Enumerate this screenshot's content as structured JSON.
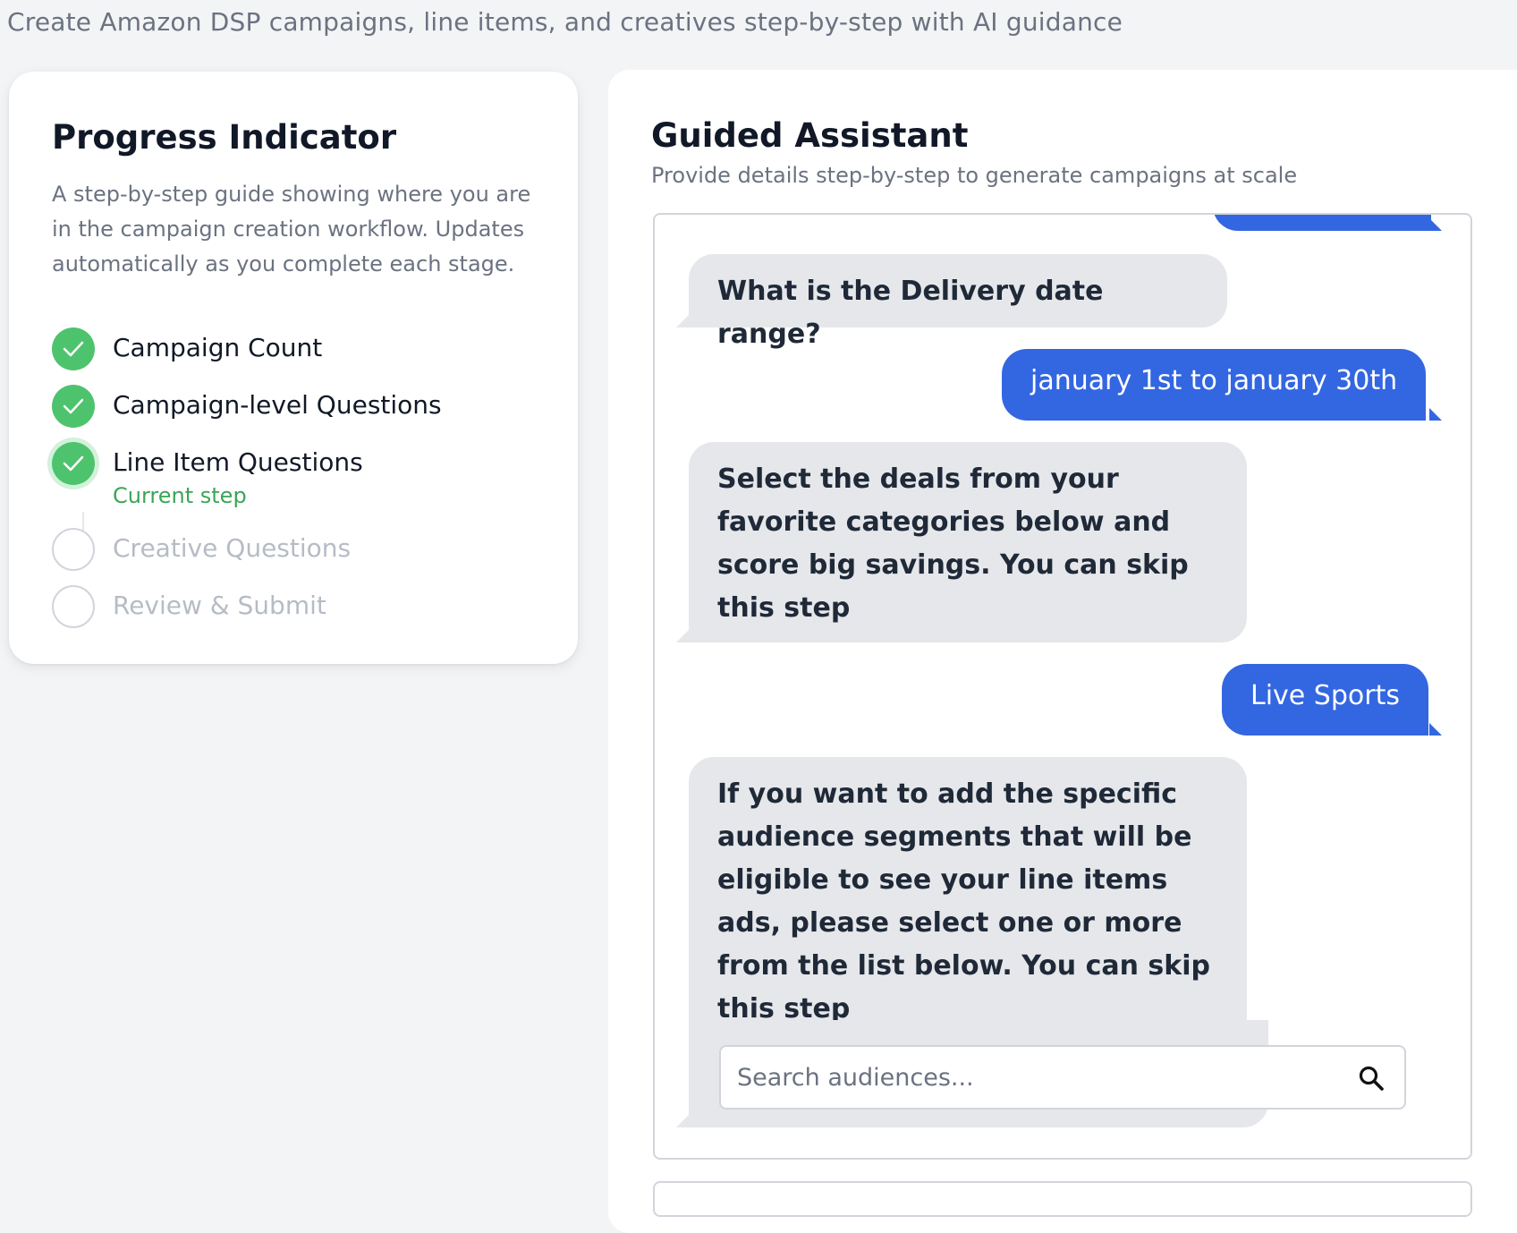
{
  "page": {
    "subtitle": "Create Amazon DSP campaigns, line items, and creatives step-by-step with AI guidance"
  },
  "progress": {
    "title": "Progress Indicator",
    "description": "A step-by-step guide showing where you are in the campaign creation workflow. Updates automatically as you complete each stage.",
    "steps": [
      {
        "label": "Campaign Count",
        "status": "done"
      },
      {
        "label": "Campaign-level Questions",
        "status": "done"
      },
      {
        "label": "Line Item Questions",
        "status": "current",
        "sublabel": "Current step"
      },
      {
        "label": "Creative Questions",
        "status": "pending"
      },
      {
        "label": "Review & Submit",
        "status": "pending"
      }
    ]
  },
  "assistant": {
    "title": "Guided Assistant",
    "subtitle": "Provide details step-by-step to generate campaigns at scale",
    "messages": [
      {
        "role": "bot",
        "text": "What is the Delivery date range?"
      },
      {
        "role": "user",
        "text": "january 1st to january 30th"
      },
      {
        "role": "bot",
        "text": "Select the deals from your favorite categories below and score big savings. You can skip this step"
      },
      {
        "role": "user",
        "text": "Live Sports"
      },
      {
        "role": "bot",
        "text": "If you want to add the specific audience segments that will be eligible to see your line items ads, please select one or more from the list below. You can skip this step"
      }
    ],
    "search": {
      "placeholder": "Search audiences..."
    }
  },
  "colors": {
    "accent_blue": "#3366e1",
    "success_green": "#4ec36d",
    "current_step_text": "#3ba556",
    "bot_bubble": "#e5e7eb"
  }
}
